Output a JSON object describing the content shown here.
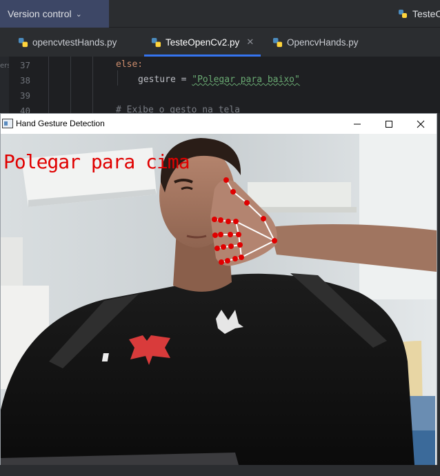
{
  "ide": {
    "version_control_label": "Version control",
    "project_label": "TesteO",
    "tabs": [
      {
        "label": "opencvtestHands.py",
        "active": false
      },
      {
        "label": "TesteOpenCv2.py",
        "active": true
      },
      {
        "label": "OpencvHands.py",
        "active": false
      }
    ],
    "side_label": "ers",
    "editor": {
      "lines": [
        {
          "no": "37",
          "keyword": "else:"
        },
        {
          "no": "38",
          "ident": "gesture",
          "op": " = ",
          "string": "\"Polegar para baixo\""
        },
        {
          "no": "39"
        },
        {
          "no": "40",
          "comment": "# Exibe o gesto na tela"
        }
      ]
    }
  },
  "cv_window": {
    "title": "Hand Gesture Detection",
    "minimize_glyph": "—",
    "close_glyph": "✕",
    "overlay_text": "Polegar para cima",
    "overlay_color": "#e00000",
    "landmark_color": "#e00000",
    "connection_color": "#ffffff"
  },
  "colors": {
    "ide_bg": "#1e1f22",
    "tab_bg": "#2b2d30",
    "accent": "#3574f0",
    "vc_bg": "#3d4766"
  }
}
